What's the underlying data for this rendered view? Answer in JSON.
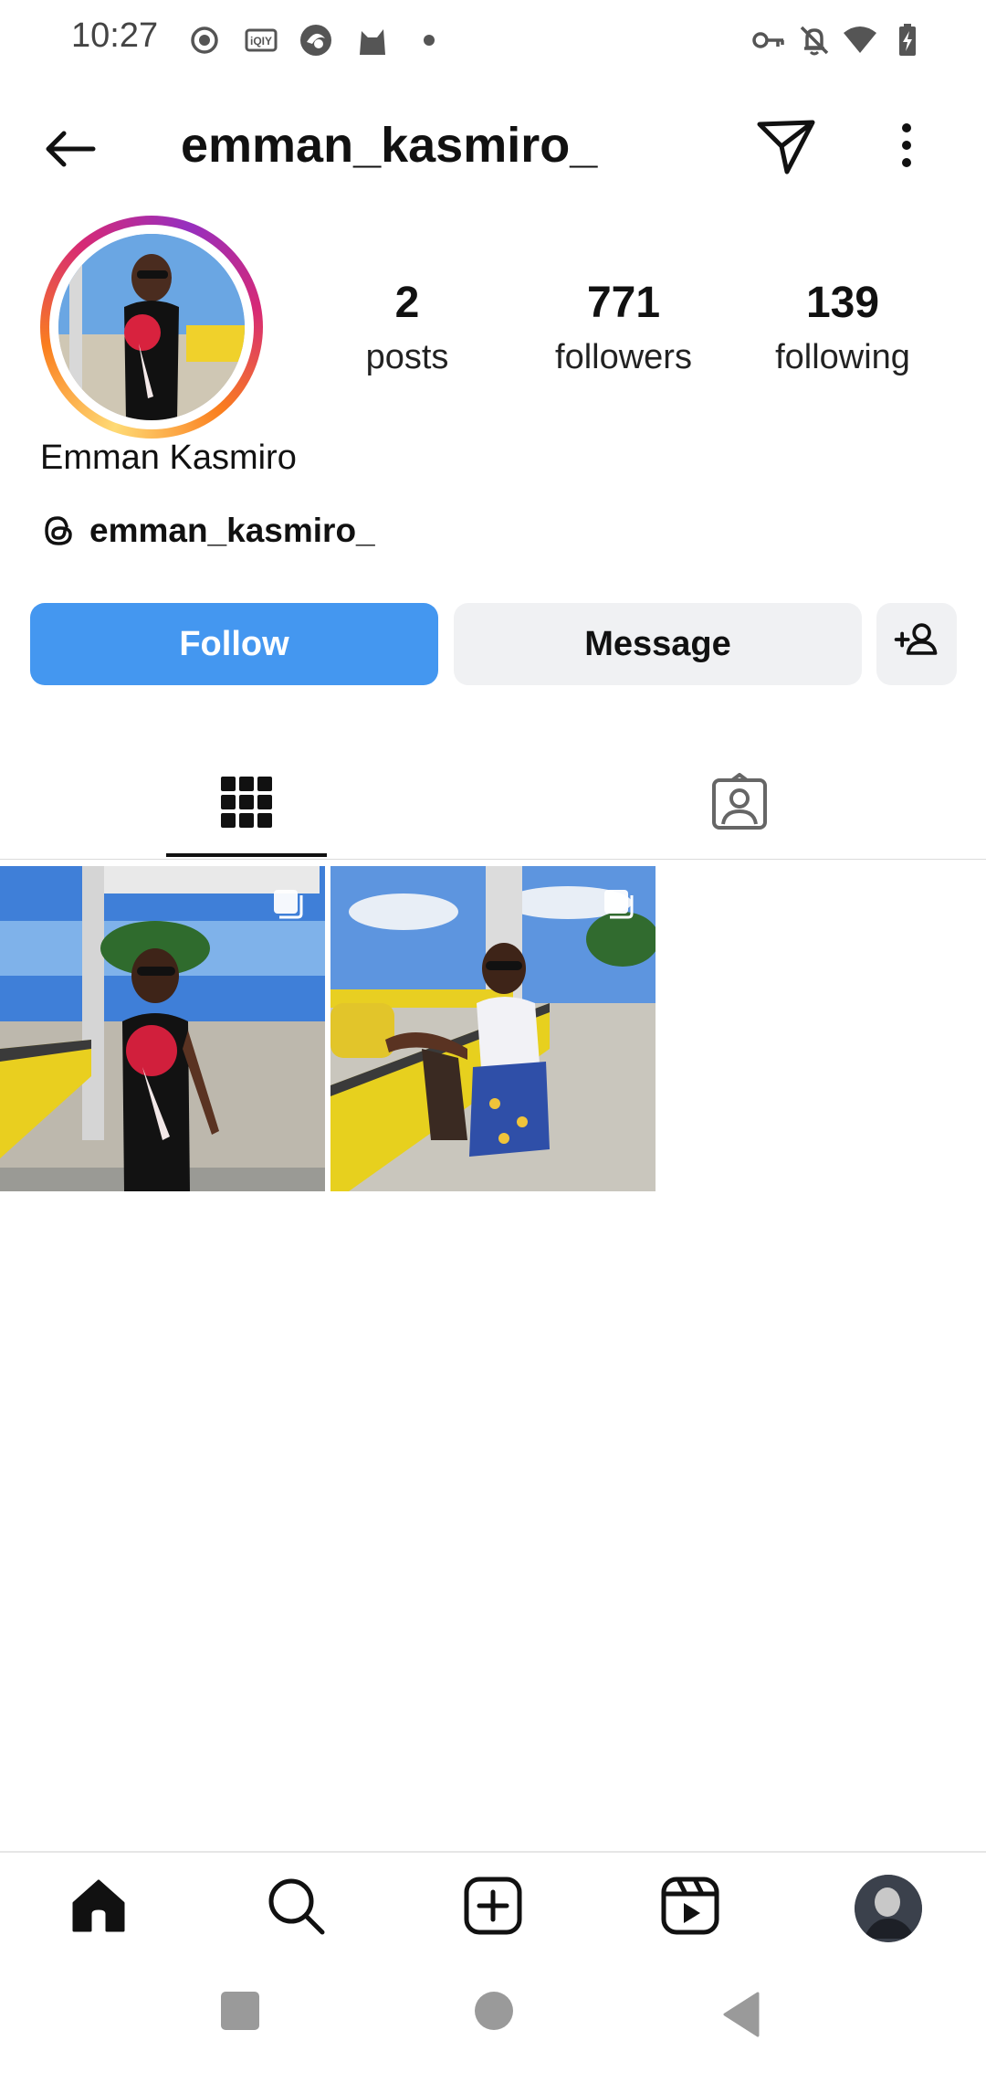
{
  "status_bar": {
    "time": "10:27",
    "left_icons": [
      "record-icon",
      "iqiyi-icon",
      "browser-icon",
      "cat-icon",
      "dot-icon"
    ],
    "right_icons": [
      "key-icon",
      "bell-off-icon",
      "wifi-icon",
      "battery-charging-icon"
    ]
  },
  "header": {
    "username": "emman_kasmiro_",
    "icons": [
      "back-arrow-icon",
      "send-icon",
      "more-vertical-icon"
    ]
  },
  "profile": {
    "full_name": "Emman Kasmiro",
    "threads_handle": "emman_kasmiro_",
    "stats": {
      "posts_count": "2",
      "posts_label": "posts",
      "followers_count": "771",
      "followers_label": "followers",
      "following_count": "139",
      "following_label": "following"
    }
  },
  "actions": {
    "follow_label": "Follow",
    "message_label": "Message"
  },
  "colors": {
    "follow_blue": "#4497f0",
    "secondary_button": "#f0f1f3",
    "text": "#111111"
  },
  "tabs": [
    {
      "name": "grid",
      "icon": "grid-icon",
      "selected": true
    },
    {
      "name": "tagged",
      "icon": "tagged-person-icon",
      "selected": false
    }
  ],
  "posts": [
    {
      "type": "carousel",
      "icon": "multiple-photos-icon"
    },
    {
      "type": "carousel",
      "icon": "multiple-photos-icon"
    }
  ],
  "bottom_nav": [
    "home-icon",
    "search-icon",
    "create-icon",
    "reels-icon",
    "profile-avatar"
  ]
}
